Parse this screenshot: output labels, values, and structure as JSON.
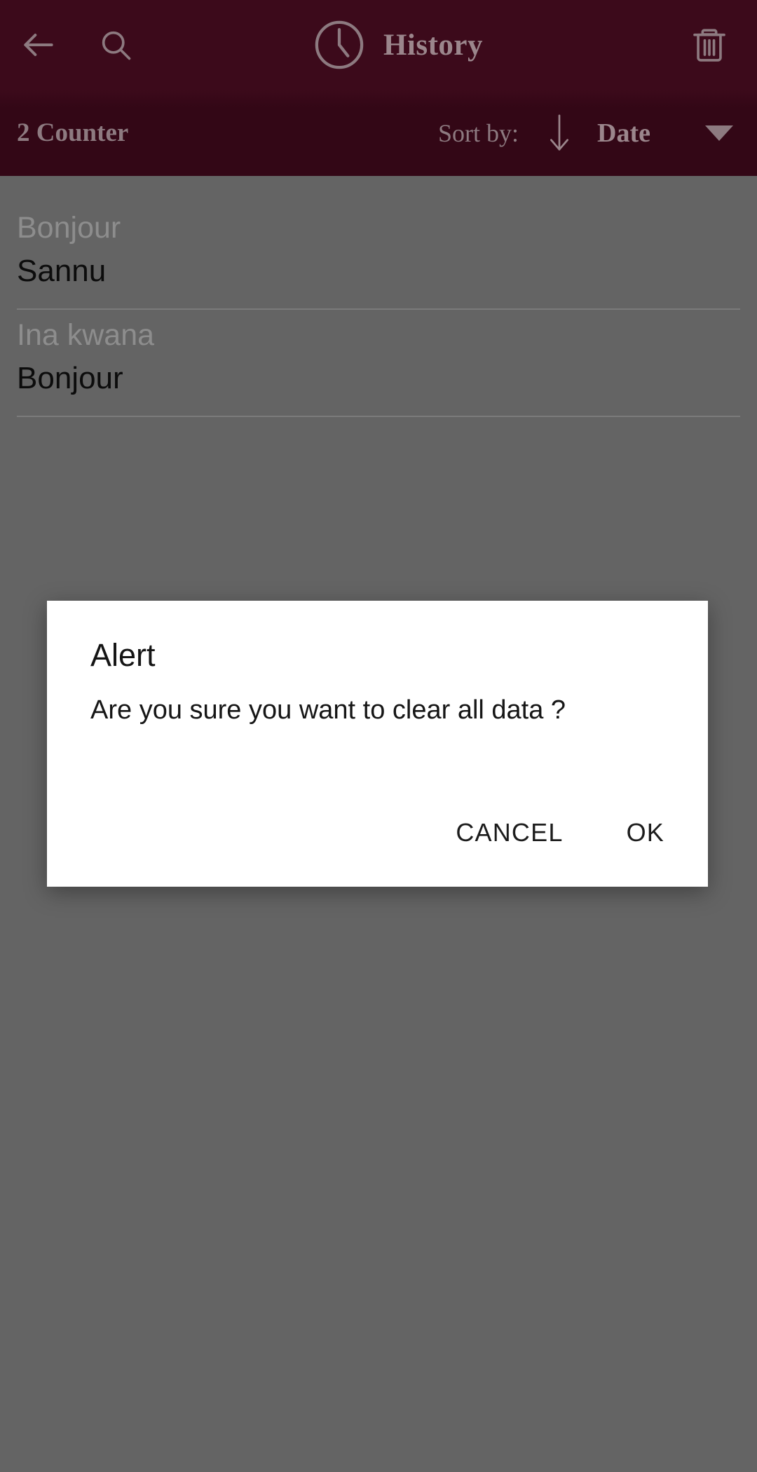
{
  "appbar": {
    "back_icon": "arrow-left-icon",
    "search_icon": "search-icon",
    "clock_icon": "clock-icon",
    "title": "History",
    "delete_icon": "trash-icon"
  },
  "sortbar": {
    "counter_label": "2 Counter",
    "sort_by_label": "Sort by:",
    "sort_direction_icon": "arrow-down-icon",
    "sort_value": "Date",
    "dropdown_icon": "caret-down-icon"
  },
  "history": {
    "items": [
      {
        "source": "Bonjour",
        "target": "Sannu"
      },
      {
        "source": "Ina kwana",
        "target": "Bonjour"
      }
    ]
  },
  "dialog": {
    "title": "Alert",
    "message": "Are you sure you want to clear all data ?",
    "cancel_label": "CANCEL",
    "ok_label": "OK"
  },
  "colors": {
    "appbar_bg": "#3c0a1b",
    "sortbar_bg": "#330716",
    "appbar_text": "#9b868c",
    "scrim": "#646464",
    "dialog_bg": "#ffffff",
    "list_target_text": "#0c0c0c",
    "list_source_text": "#8d8d8d"
  }
}
